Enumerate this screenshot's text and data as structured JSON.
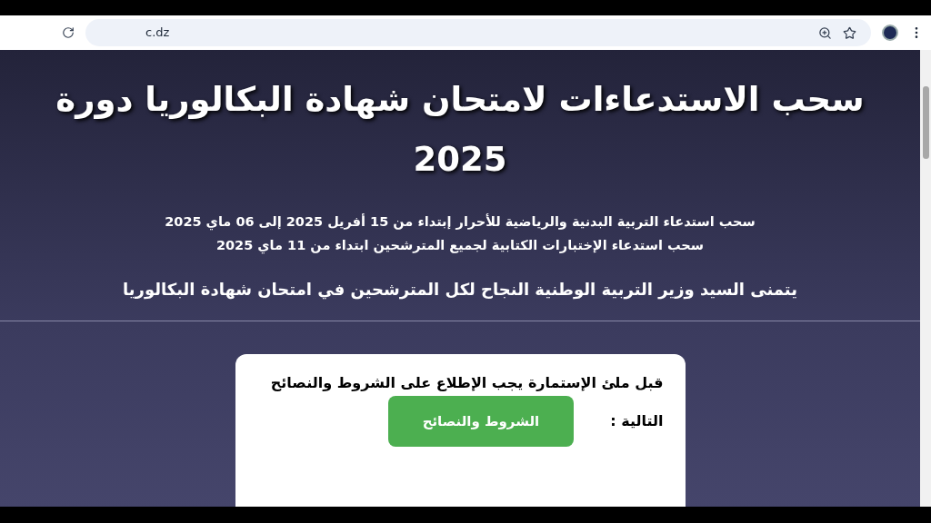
{
  "browser": {
    "url": "c.dz"
  },
  "page": {
    "title": "سحب الاستدعاءات لامتحان شهادة البكالوريا دورة 2025",
    "notices": [
      "سحب استدعاء التربية البدنية والرياضية للأحرار إبتداء من 15 أفريل 2025 إلى 06 ماي 2025",
      "سحب استدعاء الإختبارات الكتابية لجميع المترشحين ابتداء من 11 ماي 2025"
    ],
    "wish": "يتمنى السيد وزير التربية الوطنية النجاح لكل المترشحين في امتحان شهادة البكالوريا"
  },
  "card": {
    "text": "قبل ملئ الإستمارة يجب الإطلاع على الشروط والنصائح",
    "label": "التالية :",
    "button": "الشروط والنصائح"
  }
}
